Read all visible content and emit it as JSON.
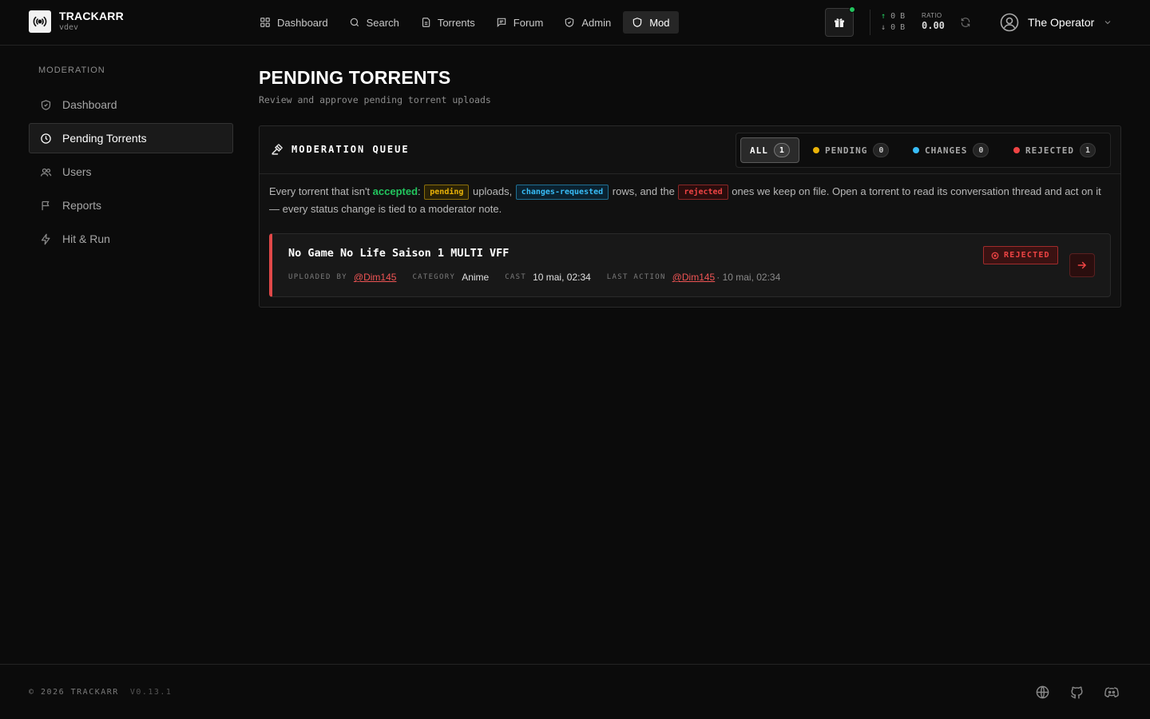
{
  "brand": {
    "name": "TRACKARR",
    "version": "vdev"
  },
  "nav": [
    {
      "label": "Dashboard",
      "icon": "grid-icon"
    },
    {
      "label": "Search",
      "icon": "search-icon"
    },
    {
      "label": "Torrents",
      "icon": "files-icon"
    },
    {
      "label": "Forum",
      "icon": "chat-icon"
    },
    {
      "label": "Admin",
      "icon": "shield-check-icon"
    },
    {
      "label": "Mod",
      "icon": "shield-icon",
      "active": true
    }
  ],
  "stats": {
    "upload": "0 B",
    "download": "0 B",
    "ratio_label": "RATIO",
    "ratio": "0.00"
  },
  "user": {
    "name": "The Operator"
  },
  "sidebar": {
    "title": "MODERATION",
    "items": [
      {
        "label": "Dashboard",
        "icon": "shield-check-icon"
      },
      {
        "label": "Pending Torrents",
        "icon": "clock-icon",
        "active": true
      },
      {
        "label": "Users",
        "icon": "users-icon"
      },
      {
        "label": "Reports",
        "icon": "flag-icon"
      },
      {
        "label": "Hit & Run",
        "icon": "zap-icon"
      }
    ]
  },
  "page": {
    "title": "PENDING TORRENTS",
    "subtitle": "Review and approve pending torrent uploads"
  },
  "queue": {
    "title": "MODERATION QUEUE",
    "filters": [
      {
        "label": "ALL",
        "count": "1",
        "active": true
      },
      {
        "label": "PENDING",
        "count": "0",
        "color": "#eab308"
      },
      {
        "label": "CHANGES",
        "count": "0",
        "color": "#38bdf8"
      },
      {
        "label": "REJECTED",
        "count": "1",
        "color": "#ef4444"
      }
    ],
    "desc": {
      "p1": "Every torrent that isn't ",
      "accepted": "accepted",
      "p2": ": ",
      "tag_pending": "pending",
      "p3": " uploads, ",
      "tag_changes": "changes-requested",
      "p4": " rows, and the ",
      "tag_rejected": "rejected",
      "p5": " ones we keep on file. Open a torrent to read its conversation thread and act on it — every status change is tied to a moderator note."
    },
    "rows": [
      {
        "title": "No Game No Life Saison 1 MULTI VFF",
        "uploaded_by_label": "UPLOADED BY",
        "uploaded_by": "@Dim145",
        "category_label": "CATEGORY",
        "category": "Anime",
        "cast_label": "CAST",
        "cast": "10 mai, 02:34",
        "last_action_label": "LAST ACTION",
        "last_action_user": "@Dim145",
        "last_action_time": "· 10 mai, 02:34",
        "status": "REJECTED"
      }
    ]
  },
  "footer": {
    "copyright": "© 2026 TRACKARR",
    "version": "V0.13.1"
  },
  "colors": {
    "accent_green": "#22c55e",
    "reject": "#ef4444",
    "pending": "#eab308",
    "changes": "#38bdf8"
  }
}
